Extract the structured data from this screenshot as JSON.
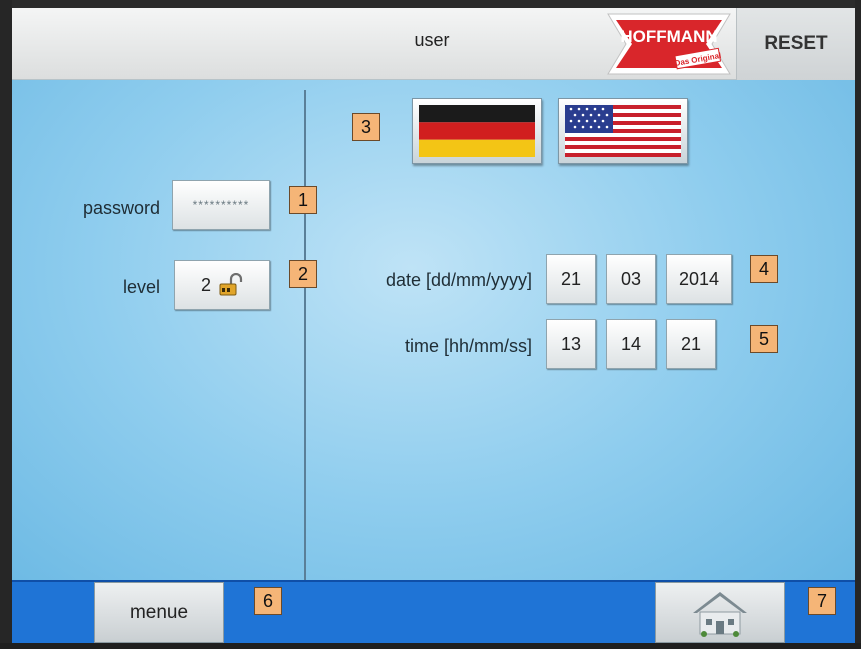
{
  "header": {
    "title": "user",
    "brand": "HOFFMANN",
    "brand_tagline": "Das Original",
    "reset_label": "RESET"
  },
  "left_panel": {
    "password_label": "password",
    "password_value": "**********",
    "level_label": "level",
    "level_value": "2"
  },
  "right_panel": {
    "date_label": "date [dd/mm/yyyy]",
    "date": {
      "day": "21",
      "month": "03",
      "year": "2014"
    },
    "time_label": "time [hh/mm/ss]",
    "time": {
      "hours": "13",
      "minutes": "14",
      "seconds": "21"
    },
    "languages": [
      "german-flag-icon",
      "us-flag-icon"
    ]
  },
  "footer": {
    "menu_label": "menue",
    "home_icon": "home-icon"
  },
  "annotations": [
    "1",
    "2",
    "3",
    "4",
    "5",
    "6",
    "7"
  ],
  "colors": {
    "screen_bg": "#8fcdee",
    "footer_bg": "#1f74d6",
    "badge_bg": "#f5b577",
    "brand_red": "#d9262b"
  }
}
